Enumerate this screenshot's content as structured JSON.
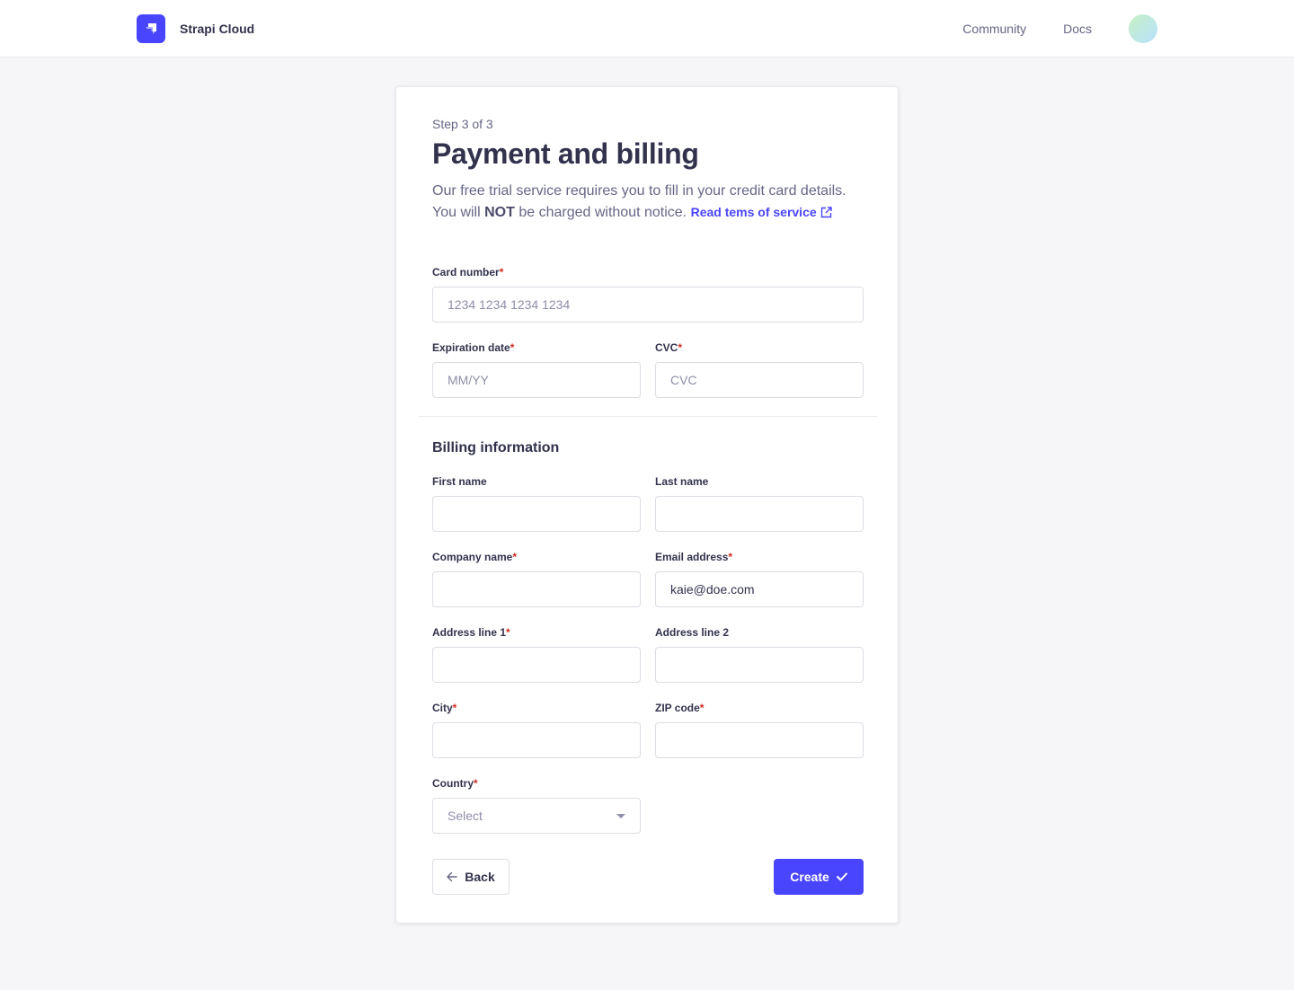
{
  "header": {
    "app_name": "Strapi Cloud",
    "logo_icon": "strapi-logo-icon",
    "nav": [
      {
        "label": "Community"
      },
      {
        "label": "Docs"
      }
    ],
    "avatar_icon": "user-avatar"
  },
  "form": {
    "step": "Step 3 of 3",
    "title": "Payment and billing",
    "description": {
      "part1": "Our free trial service requires you to fill in your credit card details. You will ",
      "bold": "NOT",
      "part2": " be charged without notice. ",
      "link": "Read tems of service",
      "link_icon": "external-link-icon"
    },
    "required_marker": "*",
    "card_number": {
      "label": "Card number",
      "required": true,
      "placeholder": "1234 1234 1234 1234",
      "value": ""
    },
    "expiration": {
      "label": "Expiration date",
      "required": true,
      "placeholder": "MM/YY",
      "value": ""
    },
    "cvc": {
      "label": "CVC",
      "required": true,
      "placeholder": "CVC",
      "value": ""
    },
    "billing_title": "Billing information",
    "first_name": {
      "label": "First name",
      "required": false,
      "value": ""
    },
    "last_name": {
      "label": "Last name",
      "required": false,
      "value": ""
    },
    "company": {
      "label": "Company name",
      "required": true,
      "value": ""
    },
    "email": {
      "label": "Email address",
      "required": true,
      "value": "kaie@doe.com"
    },
    "address1": {
      "label": "Address line 1",
      "required": true,
      "value": ""
    },
    "address2": {
      "label": "Address line 2",
      "required": false,
      "value": ""
    },
    "city": {
      "label": "City",
      "required": true,
      "value": ""
    },
    "zip": {
      "label": "ZIP code",
      "required": true,
      "value": ""
    },
    "country": {
      "label": "Country",
      "required": true,
      "placeholder": "Select",
      "icon": "chevron-down-icon"
    },
    "back_button": {
      "label": "Back",
      "icon": "arrow-left-icon"
    },
    "create_button": {
      "label": "Create",
      "icon": "check-icon"
    }
  },
  "colors": {
    "primary": "#4945ff",
    "required": "#d02b20",
    "text": "#32324d",
    "muted": "#666687",
    "background": "#f6f6f9"
  }
}
